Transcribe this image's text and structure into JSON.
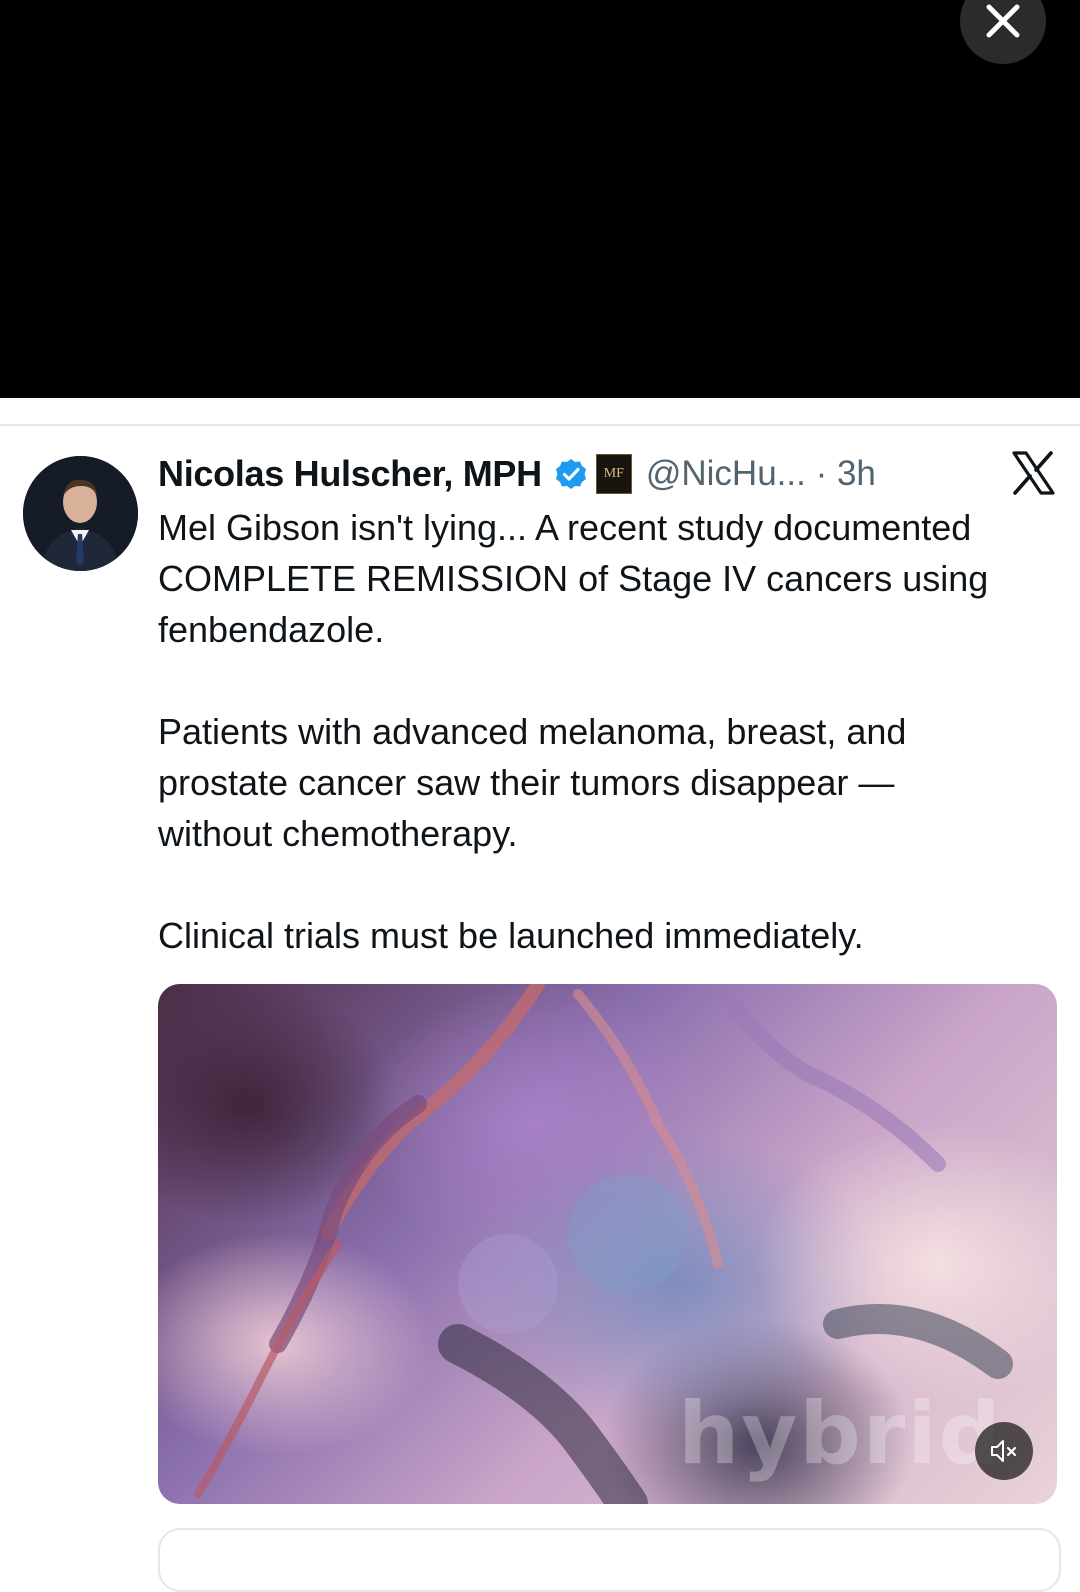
{
  "viewer": {
    "close_icon": "close-icon"
  },
  "tweet": {
    "author_name": "Nicolas Hulscher, MPH",
    "verified_icon": "verified-badge-icon",
    "affiliation_badge_text": "MF",
    "handle_time": "@NicHu... · 3h",
    "platform_icon": "x-logo-icon",
    "paragraphs": [
      "Mel Gibson isn't lying... A recent study documented COMPLETE REMISSION of Stage IV cancers using fenbendazole.",
      "Patients with advanced melanoma, breast, and prostate cancer saw their tumors disappear — without chemotherapy.",
      "Clinical trials must be launched immediately."
    ],
    "media": {
      "watermark": "hybrid",
      "mute_icon": "muted-speaker-icon"
    }
  },
  "colors": {
    "text_primary": "#0f1419",
    "text_secondary": "#536471",
    "verified_blue": "#1d9bf0"
  }
}
